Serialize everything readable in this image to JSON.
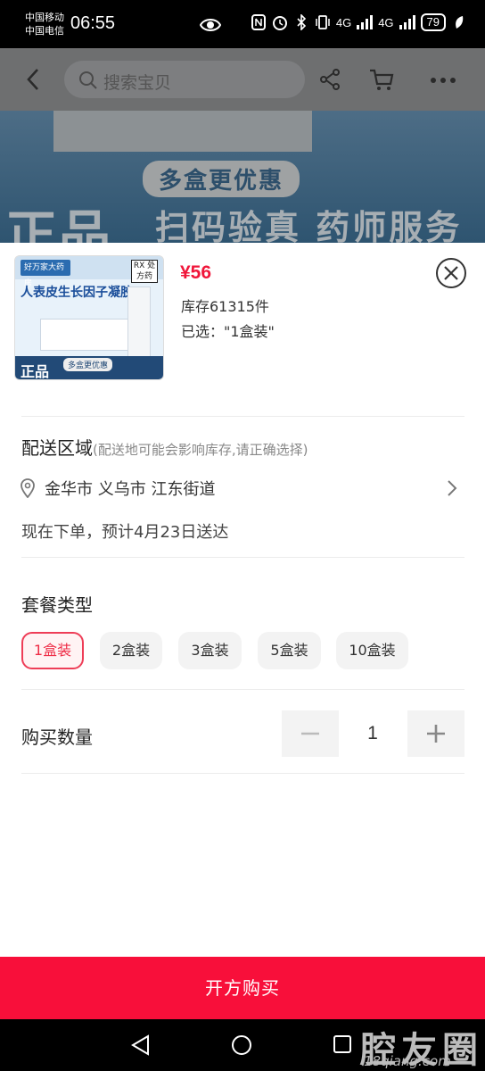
{
  "status_bar": {
    "carrier_1": "中国移动",
    "carrier_2": "中国电信",
    "time": "06:55",
    "network_1": "4G",
    "network_2": "4G",
    "battery": "79"
  },
  "background_page": {
    "search_placeholder": "搜索宝贝",
    "banner_subtitle": "多盒更优惠",
    "banner_main": "正品",
    "banner_tagline": "扫码验真 药师服务"
  },
  "product": {
    "thumbnail": {
      "pharmacy_badge": "好万家大药房",
      "rx_badge": "RX 处方药",
      "name": "人表皮生长因子凝胶",
      "band_title": "正品",
      "band_sub": "多盒更优惠"
    },
    "price": "¥56",
    "stock": "库存61315件",
    "selected": "已选：\"1盒装\""
  },
  "shipping": {
    "title": "配送区域",
    "note": "(配送地可能会影响库存,请正确选择)",
    "location": "金华市 义乌市 江东街道",
    "eta": "现在下单，预计4月23日送达"
  },
  "package": {
    "title": "套餐类型",
    "options": [
      "1盒装",
      "2盒装",
      "3盒装",
      "5盒装",
      "10盒装"
    ],
    "selected_index": 0
  },
  "quantity": {
    "title": "购买数量",
    "value": "1",
    "minus": "−",
    "plus": "+"
  },
  "action": {
    "buy_label": "开方购买"
  },
  "watermark": {
    "title": "腔友圈",
    "url": "18qiang.com"
  },
  "colors": {
    "accent": "#f80f3a",
    "price": "#f0163a"
  }
}
